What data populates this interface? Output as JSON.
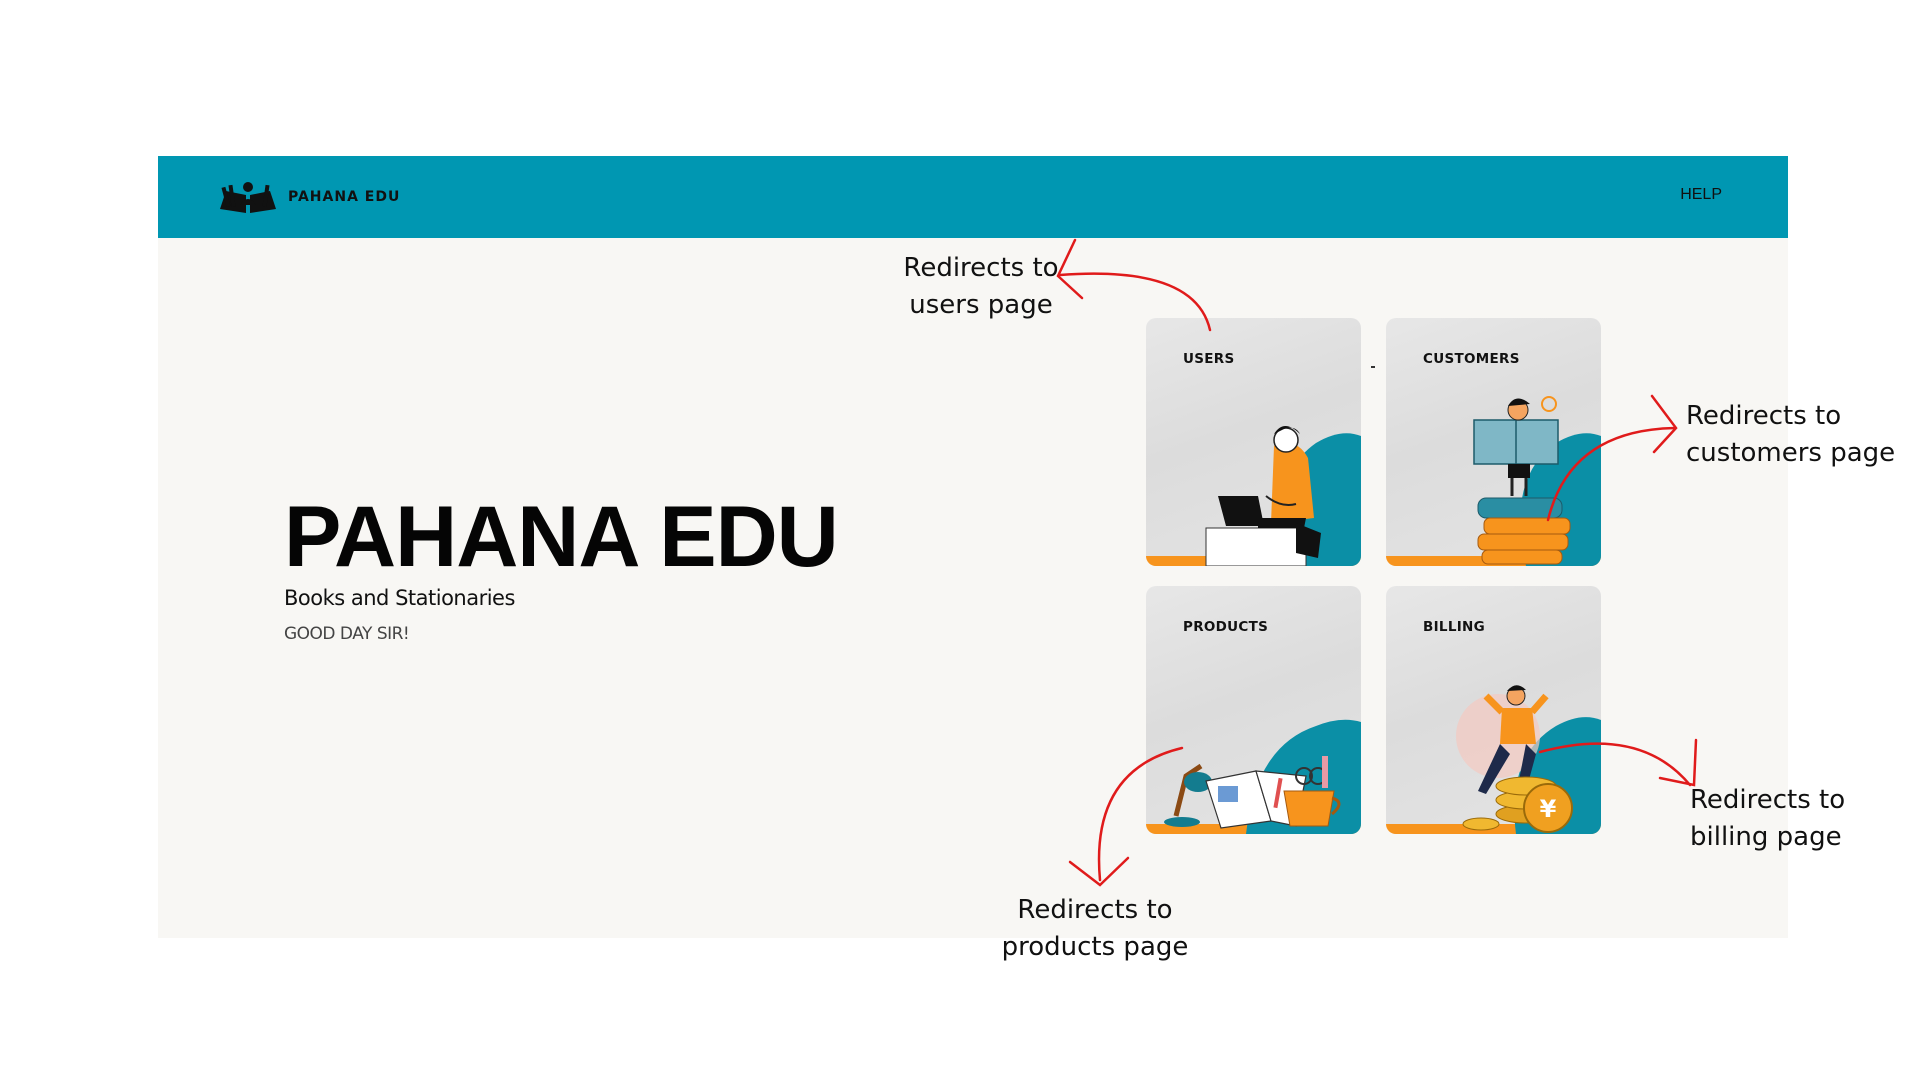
{
  "navbar": {
    "brand_name": "PAHANA EDU",
    "help_label": "HELP",
    "logo_icon": "open-book-readers-logo",
    "background_color": "#0097b2"
  },
  "hero": {
    "title": "PAHANA EDU",
    "subtitle": "Books and Stationaries",
    "greeting": "GOOD DAY SIR!"
  },
  "cards": [
    {
      "label": "USERS",
      "illustration": "man-with-laptop"
    },
    {
      "label": "CUSTOMERS",
      "illustration": "reader-on-books"
    },
    {
      "label": "PRODUCTS",
      "illustration": "desk-stationery"
    },
    {
      "label": "BILLING",
      "illustration": "man-on-coins"
    }
  ],
  "annotations": {
    "users": {
      "line1": "Redirects to",
      "line2": "users page"
    },
    "customers": {
      "line1": "Redirects to",
      "line2": "customers page"
    },
    "products": {
      "line1": "Redirects to",
      "line2": "products page"
    },
    "billing": {
      "line1": "Redirects to",
      "line2": "billing page"
    }
  },
  "colors": {
    "teal": "#0097b2",
    "card_teal": "#0b8fa6",
    "orange": "#f7941d",
    "arrow_red": "#e01b1b"
  }
}
